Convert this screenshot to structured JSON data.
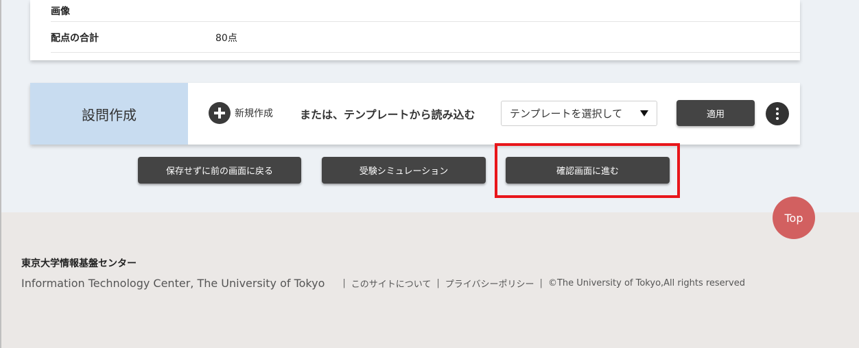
{
  "info_card": {
    "rows": [
      {
        "label": "画像",
        "value": ""
      },
      {
        "label": "配点の合計",
        "value": "80点"
      }
    ]
  },
  "question_panel": {
    "title": "設問作成",
    "new_label": "新規作成",
    "or_text": "または、テンプレートから読み込む",
    "template_select_value": "テンプレートを選択して",
    "apply_label": "適用",
    "icons": {
      "new": "plus-circle-icon",
      "more": "more-vertical-icon",
      "dropdown": "caret-down-icon"
    }
  },
  "actions": {
    "back_label": "保存せずに前の画面に戻る",
    "simulate_label": "受験シミュレーション",
    "confirm_label": "確認画面に進む"
  },
  "highlight_color": "#e8161b",
  "top_button_label": "Top",
  "footer": {
    "org_name": "東京大学情報基盤センター",
    "org_name_en": "Information Technology Center, The University of Tokyo",
    "link_about": "このサイトについて",
    "link_privacy": "プライバシーポリシー",
    "copyright": "©The University of Tokyo,All rights reserved",
    "separator": "|"
  },
  "colors": {
    "panel_title_bg": "#c8dcf0",
    "button_bg": "#444444",
    "top_button_bg": "#d26060",
    "footer_bg": "#ebe8e6"
  }
}
